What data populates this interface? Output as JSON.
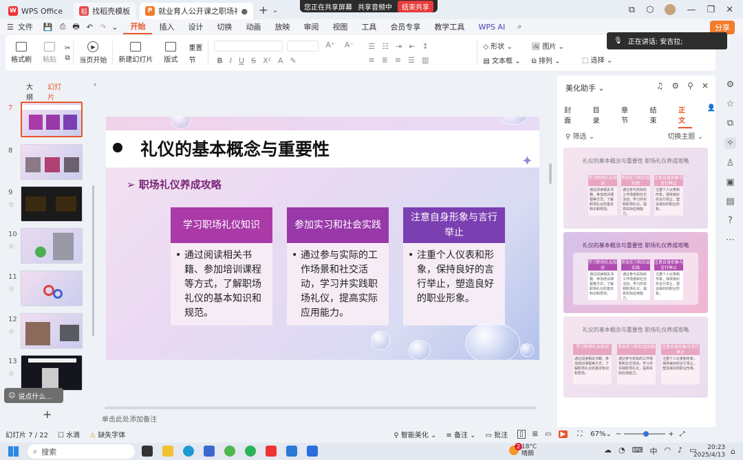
{
  "tabs": {
    "wps": "WPS Office",
    "template": "找稻壳模板",
    "doc": "就业育人公开课之职场礼仪如",
    "add": "+"
  },
  "share_bar": {
    "sharing_screen": "您正在共享屏幕",
    "sharing_audio": "共享音频中",
    "end": "结束共享"
  },
  "menu": {
    "file": "文件",
    "items": [
      "开始",
      "插入",
      "设计",
      "切换",
      "动画",
      "放映",
      "审阅",
      "视图",
      "工具",
      "会员专享",
      "教学工具",
      "WPS AI"
    ],
    "share": "分享"
  },
  "ribbon": {
    "format_painter": "格式刷",
    "paste": "粘贴",
    "from_current": "当页开始",
    "new_slide": "新建幻灯片",
    "layout": "版式",
    "section": "节",
    "reset": "重置",
    "shape": "形状",
    "picture": "图片",
    "textbox": "文本框",
    "arrange": "排列",
    "select": "选择"
  },
  "speaking": "正在讲话: 安吉拉;",
  "left_panel": {
    "outline_tab": "大纲",
    "slides_tab": "幻灯片",
    "numbers": [
      "7",
      "8",
      "9",
      "10",
      "11",
      "12",
      "13"
    ],
    "say_placeholder": "说点什么...",
    "add": "+"
  },
  "slide": {
    "title": "礼仪的基本概念与重要性",
    "subtitle": "职场礼仪养成攻略",
    "columns": [
      {
        "header": "学习职场礼仪知识",
        "body": "通过阅读相关书籍、参加培训课程等方式，了解职场礼仪的基本知识和规范。",
        "color": "#a93aa8"
      },
      {
        "header": "参加实习和社会实践",
        "body": "通过参与实际的工作场景和社交活动，学习并实践职场礼仪，提高实际应用能力。",
        "color": "#9838a9"
      },
      {
        "header": "注意自身形象与言行举止",
        "body": "注重个人仪表和形象，保持良好的言行举止，塑造良好的职业形象。",
        "color": "#7a3fb0"
      }
    ]
  },
  "notes_placeholder": "单击此处添加备注",
  "right_panel": {
    "title": "美化助手",
    "tabs": [
      "封面",
      "目录",
      "章节",
      "结束",
      "正文"
    ],
    "filter": "筛选",
    "switch_theme": "切换主题",
    "tpl_title": "礼仪的基本概念与重要性 职场礼仪养成攻略",
    "tpl_headers": [
      "学习职场礼仪知识",
      "参加实习和社会实践",
      "注意自身形象与言行举止"
    ],
    "tpl_bodies": [
      "通过阅读相关书籍、参加培训课程等方式，了解职场礼仪的基本知识和规范。",
      "通过参与实际的工作场景和社交活动，学习并实践职场礼仪，提高实际应用能力。",
      "注重个人仪表和形象，保持良好的言行举止，塑造良好的职业形象。"
    ]
  },
  "status": {
    "slide_count": "幻灯片 7 / 22",
    "theme": "水滴",
    "missing_font": "缺失字体",
    "smart_beautify": "智能美化",
    "notes": "备注",
    "comments": "批注",
    "zoom": "67%"
  },
  "taskbar": {
    "search": "搜索",
    "weather_temp": "18°C",
    "weather_desc": "晴朗",
    "badge": "2",
    "ime": "中",
    "time": "20:23",
    "date": "2025/4/13"
  },
  "colors": {
    "accent": "#e8552a",
    "share": "#f07c2c"
  }
}
